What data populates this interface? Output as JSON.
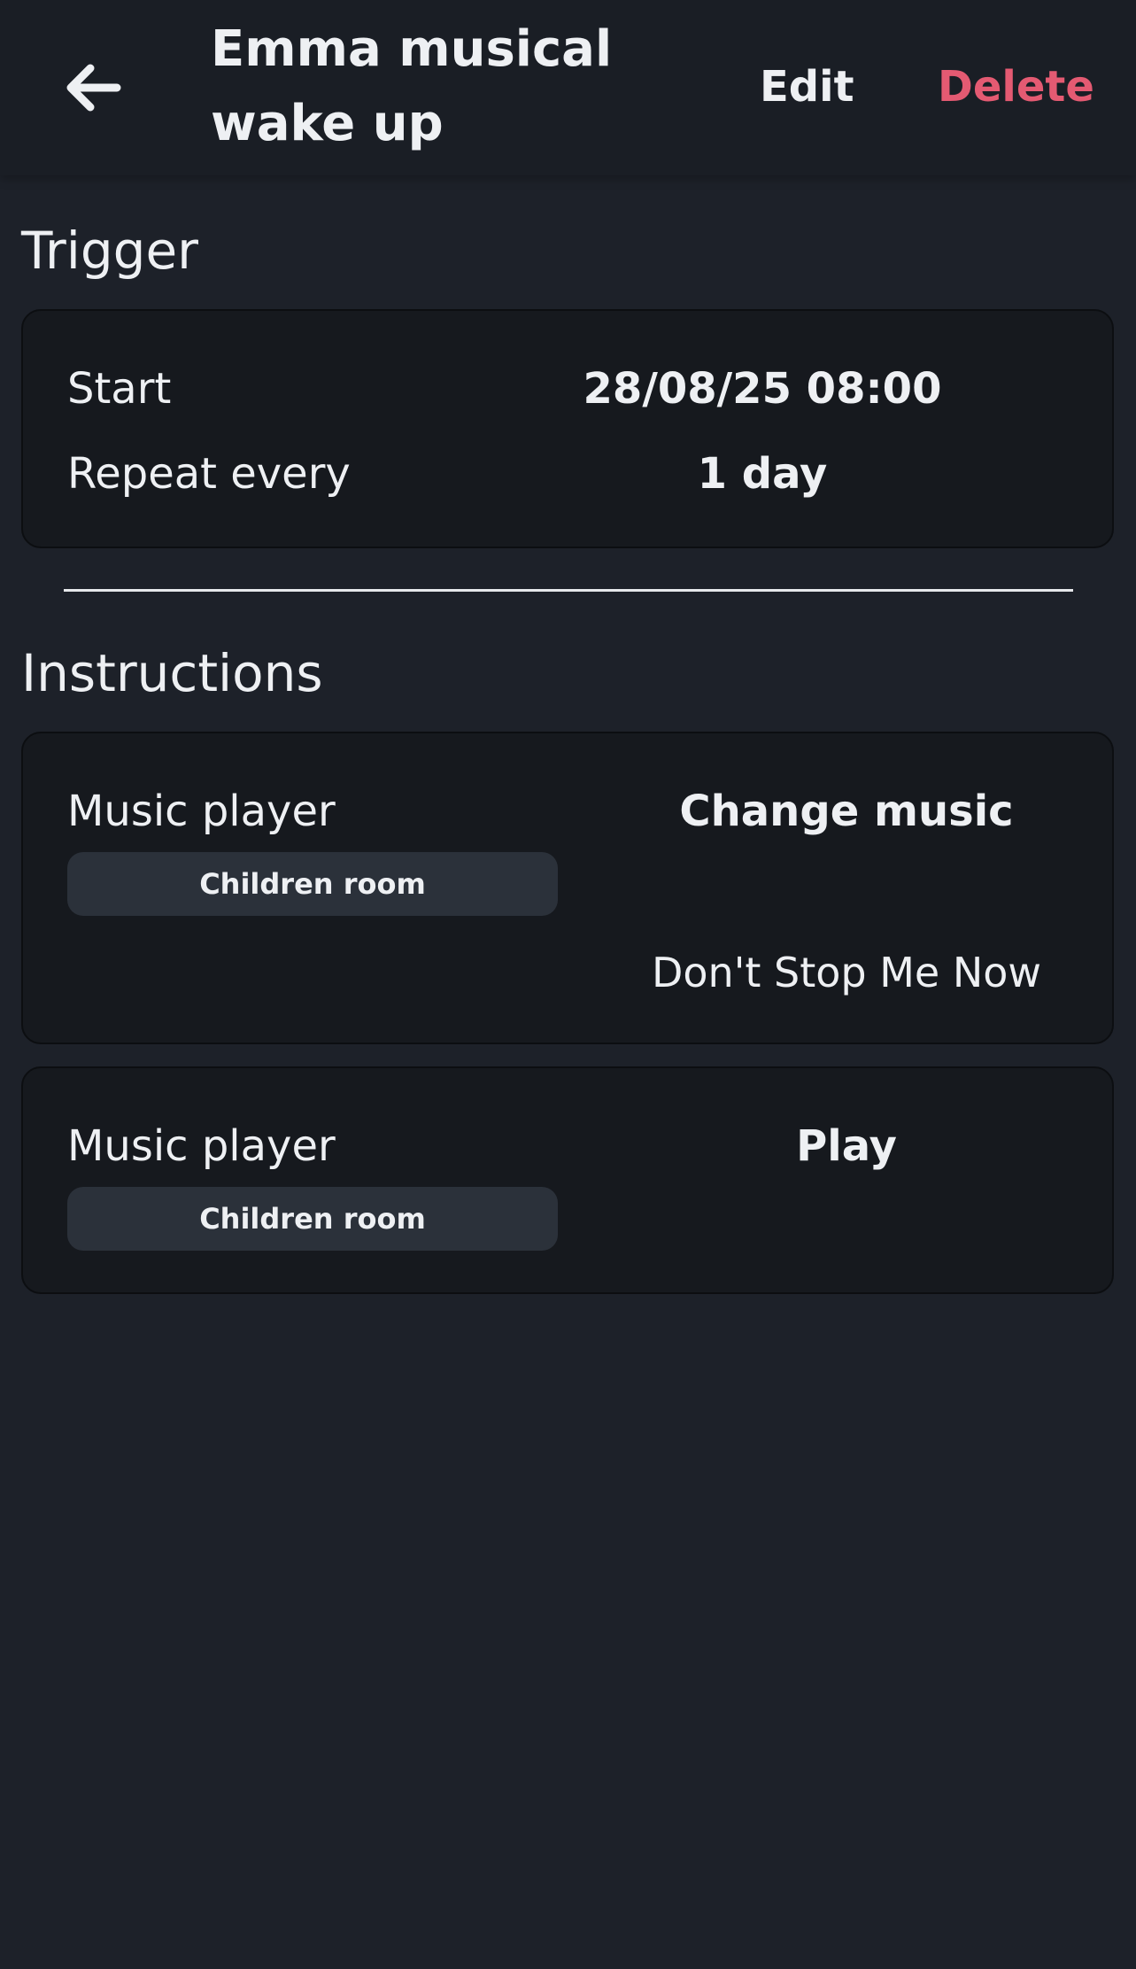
{
  "header": {
    "title": "Emma musical wake up",
    "edit_label": "Edit",
    "delete_label": "Delete",
    "back_icon": "arrow-left-icon"
  },
  "trigger": {
    "title": "Trigger",
    "start_label": "Start",
    "start_value": "28/08/25 08:00",
    "repeat_label": "Repeat every",
    "repeat_value": "1 day"
  },
  "instructions": {
    "title": "Instructions",
    "items": [
      {
        "device": "Music player",
        "room": "Children room",
        "action": "Change music",
        "detail": "Don't Stop Me Now"
      },
      {
        "device": "Music player",
        "room": "Children room",
        "action": "Play"
      }
    ]
  },
  "colors": {
    "background": "#1d2129",
    "card": "#16191e",
    "chip": "#2b313a",
    "danger": "#e45a72",
    "text": "#eef0f3"
  }
}
